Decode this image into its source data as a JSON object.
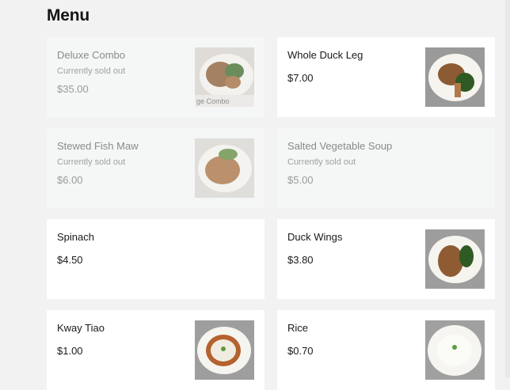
{
  "page": {
    "title": "Menu"
  },
  "items": [
    {
      "name": "Deluxe Combo",
      "status": "Currently sold out",
      "price": "$35.00",
      "sold_out": true,
      "image_text": "ge Combo"
    },
    {
      "name": "Whole Duck Leg",
      "status": "",
      "price": "$7.00",
      "sold_out": false
    },
    {
      "name": "Stewed Fish Maw",
      "status": "Currently sold out",
      "price": "$6.00",
      "sold_out": true
    },
    {
      "name": "Salted Vegetable Soup",
      "status": "Currently sold out",
      "price": "$5.00",
      "sold_out": true
    },
    {
      "name": "Spinach",
      "status": "",
      "price": "$4.50",
      "sold_out": false
    },
    {
      "name": "Duck Wings",
      "status": "",
      "price": "$3.80",
      "sold_out": false
    },
    {
      "name": "Kway Tiao",
      "status": "",
      "price": "$1.00",
      "sold_out": false
    },
    {
      "name": "Rice",
      "status": "",
      "price": "$0.70",
      "sold_out": false
    }
  ]
}
